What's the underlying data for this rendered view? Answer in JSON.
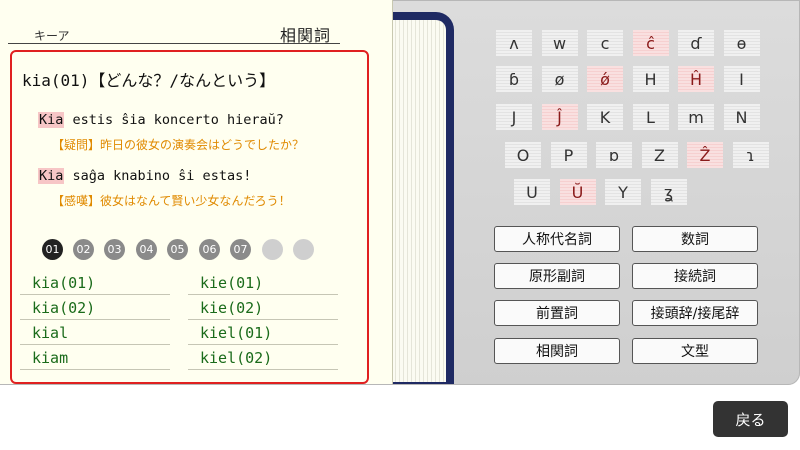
{
  "page": {
    "tab_label": "キーア",
    "category": "相関詞"
  },
  "entry": {
    "headword": "kia(01)【どんな？/なんという】",
    "examples": [
      {
        "highlight": "Kia",
        "rest": " estis ŝia koncerto hieraŭ?",
        "translation": "【疑問】昨日の彼女の演奏会はどうでしたか？"
      },
      {
        "highlight": "Kia",
        "rest": " saĝa knabino ŝi estas!",
        "translation": "【感嘆】彼女はなんて賢い少女なんだろう！"
      }
    ]
  },
  "pages": [
    "01",
    "02",
    "03",
    "04",
    "05",
    "06",
    "07",
    "",
    ""
  ],
  "active_page": "01",
  "word_list": {
    "left": [
      "kia(01)",
      "kia(02)",
      "kial",
      "kiam"
    ],
    "right": [
      "kie(01)",
      "kie(02)",
      "kiel(01)",
      "kiel(02)"
    ]
  },
  "keys": [
    [
      "ʌ",
      "w",
      "c",
      "ĉ",
      "ɗ",
      "ɵ"
    ],
    [
      "ɓ",
      "ø",
      "ǿ",
      "H",
      "Ĥ",
      "I"
    ],
    [
      "J",
      "Ĵ",
      "K",
      "L",
      "m",
      "N"
    ],
    [
      "O",
      "P",
      "ɒ",
      "Z",
      "Ẑ",
      "ɿ"
    ],
    [
      "U",
      "Ŭ",
      "Y",
      "ʓ"
    ]
  ],
  "pink_keys": [
    "ĉ",
    "ǿ",
    "Ĥ",
    "Ĵ",
    "Ẑ",
    "Ŭ"
  ],
  "categories": [
    [
      "人称代名詞",
      "数詞"
    ],
    [
      "原形副詞",
      "接続詞"
    ],
    [
      "前置詞",
      "接頭辞/接尾辞"
    ],
    [
      "相関詞",
      "文型"
    ]
  ],
  "back_label": "戻る"
}
